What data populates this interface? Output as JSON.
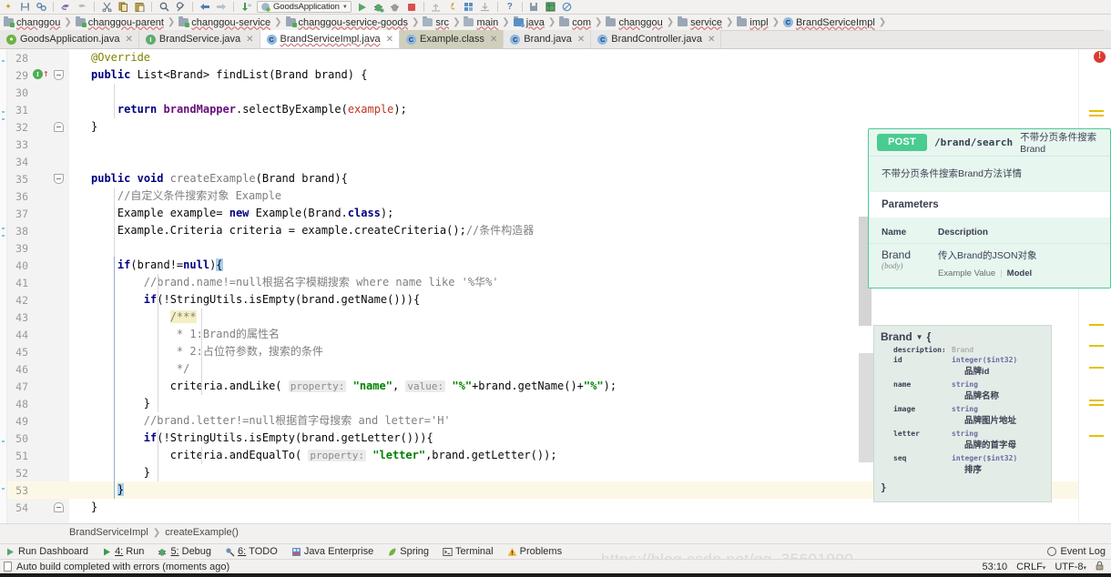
{
  "toolbar": {
    "icons": [
      "save-all-icon",
      "sync-icon",
      "undo-icon",
      "redo-icon",
      "cut-icon",
      "copy-icon",
      "paste-icon",
      "find-icon",
      "replace-icon",
      "back-icon",
      "forward-icon",
      "compile-icon"
    ],
    "run_config": "GoodsApplication",
    "run_label": "run-icon",
    "debug_label": "debug-icon",
    "coverage_label": "coverage-icon",
    "stop_label": "stop-icon",
    "help_label": "?",
    "right_icons": [
      "update-project-icon",
      "settings-icon",
      "project-structure-icon",
      "search-everywhere-icon"
    ]
  },
  "navbar": {
    "items": [
      {
        "label": "changgou",
        "icon": "module-folder-icon"
      },
      {
        "label": "changgou-parent",
        "icon": "module-folder-icon"
      },
      {
        "label": "changgou-service",
        "icon": "module-folder-icon"
      },
      {
        "label": "changgou-service-goods",
        "icon": "module-folder-icon"
      },
      {
        "label": "src",
        "icon": "folder-icon"
      },
      {
        "label": "main",
        "icon": "folder-icon"
      },
      {
        "label": "java",
        "icon": "source-folder-icon"
      },
      {
        "label": "com",
        "icon": "package-icon"
      },
      {
        "label": "changgou",
        "icon": "package-icon"
      },
      {
        "label": "service",
        "icon": "package-icon"
      },
      {
        "label": "impl",
        "icon": "package-icon"
      },
      {
        "label": "BrandServiceImpl",
        "icon": "class-icon"
      }
    ]
  },
  "tabs": [
    {
      "label": "GoodsApplication.java",
      "icon": "spring-class-icon",
      "state": "normal"
    },
    {
      "label": "BrandService.java",
      "icon": "interface-icon",
      "state": "normal"
    },
    {
      "label": "BrandServiceImpl.java",
      "icon": "class-icon",
      "state": "active"
    },
    {
      "label": "Example.class",
      "icon": "class-icon",
      "state": "highlighted"
    },
    {
      "label": "Brand.java",
      "icon": "class-icon",
      "state": "normal"
    },
    {
      "label": "BrandController.java",
      "icon": "class-icon",
      "state": "normal"
    }
  ],
  "editor": {
    "first_line": 28,
    "lines": [
      {
        "n": 28,
        "fold": null,
        "marker": null
      },
      {
        "n": 29,
        "fold": "open",
        "marker": "override-implements"
      },
      {
        "n": 30,
        "fold": null,
        "marker": null
      },
      {
        "n": 31,
        "fold": null,
        "marker": null
      },
      {
        "n": 32,
        "fold": "end",
        "marker": null
      },
      {
        "n": 33,
        "fold": null,
        "marker": null
      },
      {
        "n": 34,
        "fold": null,
        "marker": null
      },
      {
        "n": 35,
        "fold": "open",
        "marker": null
      },
      {
        "n": 36,
        "fold": null,
        "marker": null
      },
      {
        "n": 37,
        "fold": null,
        "marker": null
      },
      {
        "n": 38,
        "fold": null,
        "marker": null
      },
      {
        "n": 39,
        "fold": null,
        "marker": null
      },
      {
        "n": 40,
        "fold": null,
        "marker": null
      },
      {
        "n": 41,
        "fold": null,
        "marker": null
      },
      {
        "n": 42,
        "fold": null,
        "marker": null
      },
      {
        "n": 43,
        "fold": null,
        "marker": null
      },
      {
        "n": 44,
        "fold": null,
        "marker": null
      },
      {
        "n": 45,
        "fold": null,
        "marker": null
      },
      {
        "n": 46,
        "fold": null,
        "marker": null
      },
      {
        "n": 47,
        "fold": null,
        "marker": null
      },
      {
        "n": 48,
        "fold": null,
        "marker": null
      },
      {
        "n": 49,
        "fold": null,
        "marker": null
      },
      {
        "n": 50,
        "fold": null,
        "marker": null
      },
      {
        "n": 51,
        "fold": null,
        "marker": null
      },
      {
        "n": 52,
        "fold": null,
        "marker": null
      },
      {
        "n": 53,
        "fold": null,
        "marker": null
      },
      {
        "n": 54,
        "fold": "end",
        "marker": null
      }
    ],
    "code_text": [
      "@Override",
      "public List<Brand> findList(Brand brand) {",
      "",
      "    return brandMapper.selectByExample(example);",
      "}",
      "",
      "",
      "public void createExample(Brand brand){",
      "    //自定义条件搜索对象 Example",
      "    Example example= new Example(Brand.class);",
      "    Example.Criteria criteria = example.createCriteria();//条件构造器",
      "",
      "    if(brand!=null){",
      "        //brand.name!=null根据名字模糊搜索 where name like '%华%'",
      "        if(!StringUtils.isEmpty(brand.getName())){",
      "            /***",
      "             * 1:Brand的属性名",
      "             * 2:占位符参数，搜索的条件",
      "             */",
      "            criteria.andLike( property: \"name\", value: \"%\"+brand.getName()+\"%\");",
      "        }",
      "        //brand.letter!=null根据首字母搜索 and letter='H'",
      "        if(!StringUtils.isEmpty(brand.getLetter())){",
      "            criteria.andEqualTo( property: \"letter\",brand.getLetter());",
      "        }",
      "    }",
      "}"
    ],
    "error_badge": "!",
    "highlight_line": 53
  },
  "breadcrumb": {
    "class": "BrandServiceImpl",
    "method": "createExample()"
  },
  "toolwindows": [
    {
      "label": "Run Dashboard",
      "icon": "run-dashboard-icon",
      "mnemonic": ""
    },
    {
      "label": "Run",
      "icon": "run-icon",
      "mnemonic": "4:"
    },
    {
      "label": "Debug",
      "icon": "debug-icon",
      "mnemonic": "5:"
    },
    {
      "label": "TODO",
      "icon": "todo-icon",
      "mnemonic": "6:"
    },
    {
      "label": "Java Enterprise",
      "icon": "java-enterprise-icon",
      "mnemonic": ""
    },
    {
      "label": "Spring",
      "icon": "spring-leaf-icon",
      "mnemonic": ""
    },
    {
      "label": "Terminal",
      "icon": "terminal-icon",
      "mnemonic": ""
    },
    {
      "label": "Problems",
      "icon": "warning-icon",
      "mnemonic": ""
    }
  ],
  "event_log": "Event Log",
  "status": {
    "message": "Auto build completed with errors (moments ago)",
    "caret": "53:10",
    "line_sep": "CRLF",
    "encoding": "UTF-8",
    "lock_icon": "lock-icon"
  },
  "watermark": "https://blog.csdn.net/qq_35601990",
  "swagger": {
    "method": "POST",
    "path": "/brand/search",
    "summary": "不带分页条件搜索Brand",
    "description": "不带分页条件搜索Brand方法详情",
    "parameters_title": "Parameters",
    "col_name": "Name",
    "col_description": "Description",
    "param_name": "Brand",
    "param_in": "(body)",
    "param_desc": "传入Brand的JSON对象",
    "tab_example": "Example Value",
    "tab_model": "Model",
    "model_title": "Brand",
    "model_open_brace": "{",
    "model_close_brace": "}",
    "model_rows": [
      {
        "key": "description:",
        "type": "Brand",
        "cn": "",
        "gray": true
      },
      {
        "key": "id",
        "type": "integer($int32)",
        "cn": "品牌id",
        "gray": false
      },
      {
        "key": "name",
        "type": "string",
        "cn": "品牌名称",
        "gray": false
      },
      {
        "key": "image",
        "type": "string",
        "cn": "品牌图片地址",
        "gray": false
      },
      {
        "key": "letter",
        "type": "string",
        "cn": "品牌的首字母",
        "gray": false
      },
      {
        "key": "seq",
        "type": "integer($int32)",
        "cn": "排序",
        "gray": false
      }
    ]
  },
  "colors": {
    "swagger_green": "#49cc90",
    "swagger_bg": "#e8f6f0",
    "error_red": "#dc3a31",
    "warn_yellow": "#e5c000",
    "keyword_blue": "#000080",
    "string_green": "#008000",
    "field_purple": "#660e7a"
  }
}
